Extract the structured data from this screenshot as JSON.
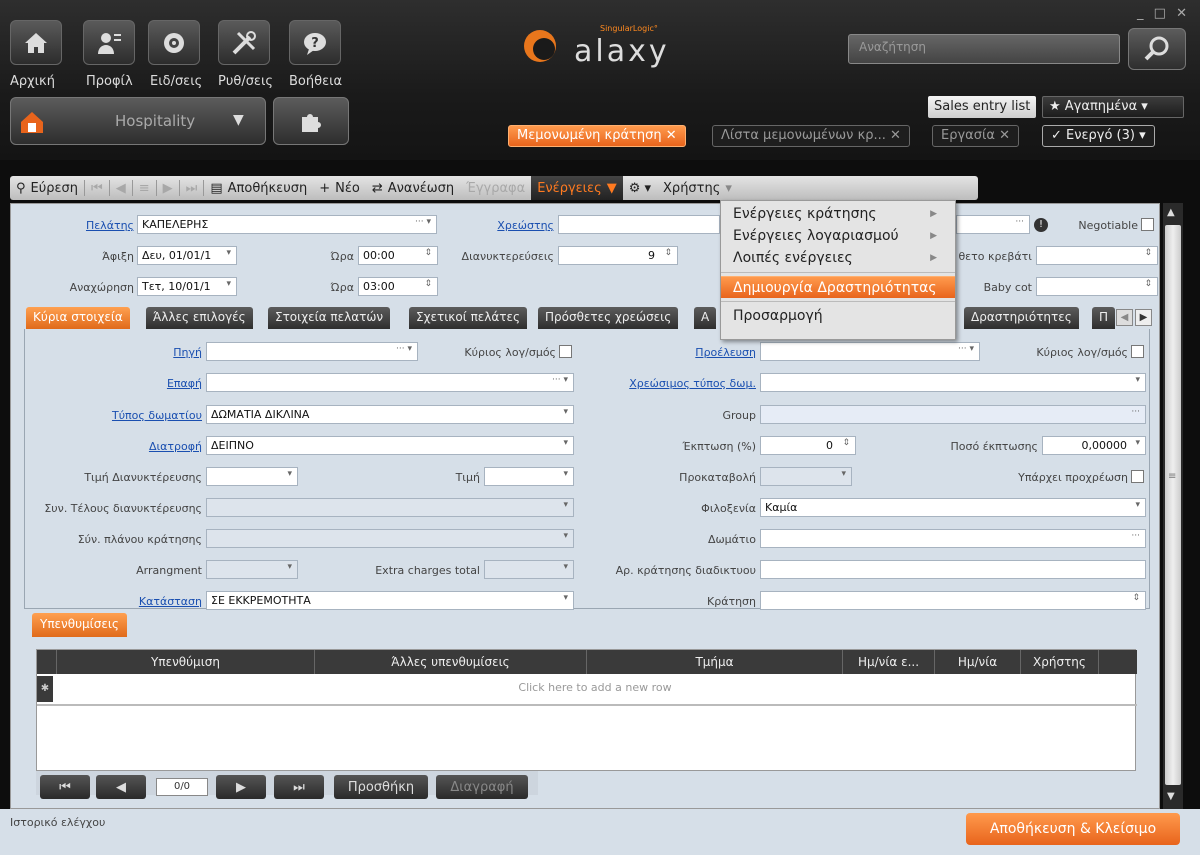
{
  "window": {
    "controls": "_ □ ✕"
  },
  "nav": [
    {
      "label": "Αρχική",
      "icon": "home-icon"
    },
    {
      "label": "Προφίλ",
      "icon": "profile-icon"
    },
    {
      "label": "Ειδ/σεις",
      "icon": "notifications-icon"
    },
    {
      "label": "Ρυθ/σεις",
      "icon": "settings-tools-icon"
    },
    {
      "label": "Βοήθεια",
      "icon": "help-icon"
    }
  ],
  "app": {
    "module": "Hospitality",
    "logo_small": "SingularLogic°",
    "logo_text": "alaxy",
    "logo_initial": "G"
  },
  "search": {
    "placeholder": "Αναζήτηση"
  },
  "quick": {
    "sales": "Sales entry list",
    "favorites": "★ Αγαπημένα ▾"
  },
  "tabs": [
    {
      "label": "Μεμονωμένη κράτηση ✕"
    },
    {
      "label": "Λίστα μεμονωμένων κρ... ✕"
    },
    {
      "label": "Εργασία ✕"
    },
    {
      "label": "✓ Ενεργό (3) ▾"
    }
  ],
  "toolbar": {
    "find": "Εύρεση",
    "save": "Αποθήκευση",
    "new": "Νέο",
    "refresh": "Ανανέωση",
    "docs": "Έγγραφα",
    "actions": "Ενέργειες",
    "user": "Χρήστης"
  },
  "menu": {
    "items": [
      "Ενέργειες κράτησης",
      "Ενέργειες λογαριασμού",
      "Λοιπές ενέργειες",
      "Δημιουργία Δραστηριότητας",
      "Προσαρμογή"
    ]
  },
  "header": {
    "client_label": "Πελάτης",
    "client": "ΚΑΠΕΛΕΡΗΣ",
    "debtor_label": "Χρεώστης",
    "negotiable": "Negotiable",
    "arrival_label": "Άφιξη",
    "arrival": "Δευ, 01/01/1",
    "time_label": "Ώρα",
    "arr_time": "00:00",
    "nights_label": "Διανυκτερεύσεις",
    "nights": "9",
    "departure_label": "Αναχώρηση",
    "departure": "Τετ, 10/01/1",
    "dep_time": "03:00",
    "extra_bed": "θετο κρεβάτι",
    "babycot": "Baby cot"
  },
  "subtabs": [
    "Κύρια στοιχεία",
    "Άλλες επιλογές",
    "Στοιχεία πελατών",
    "Σχετικοί πελάτες",
    "Πρόσθετες χρεώσεις",
    "Α",
    "Δραστηριότητες",
    "Π"
  ],
  "form": {
    "source": "Πηγή",
    "main_acc": "Κύριος λογ/σμός",
    "origin": "Προέλευση",
    "contact": "Επαφή",
    "charge_room": "Χρεώσιμος τύπος δωμ.",
    "roomtype_label": "Τύπος δωματίου",
    "roomtype": "ΔΩΜΑΤΙΑ ΔΙΚΛΙΝΑ",
    "group": "Group",
    "board_label": "Διατροφή",
    "board": "ΔΕΙΠΝΟ",
    "discount_label": "Έκπτωση (%)",
    "discount": "0",
    "disc_amt_label": "Ποσό έκπτωσης",
    "disc_amt": "0,00000",
    "night_price": "Τιμή Διανυκτέρευσης",
    "price": "Τιμή",
    "deposit": "Προκαταβολή",
    "precharge": "Υπάρχει προχρέωση",
    "tax": "Συν. Τέλους διανυκτέρευσης",
    "hospitality_label": "Φιλοξενία",
    "hospitality": "Καμία",
    "plan": "Σύν. πλάνου κράτησης",
    "room": "Δωμάτιο",
    "arrangement": "Arrangment",
    "extra_charges": "Extra charges total",
    "web_res": "Αρ. κράτησης διαδικτυου",
    "status_label": "Κατάσταση",
    "status": "ΣΕ ΕΚΚΡΕΜΟΤΗΤΑ",
    "booking": "Κράτηση"
  },
  "reminders": {
    "tab": "Υπενθυμίσεις",
    "columns": [
      "Υπενθύμιση",
      "Άλλες υπενθυμίσεις",
      "Τμήμα",
      "Ημ/νία ε...",
      "Ημ/νία",
      "Χρήστης"
    ],
    "new_row": "Click here to add a new row",
    "pager": "0/0",
    "add": "Προσθήκη",
    "delete": "Διαγραφή"
  },
  "footer": {
    "audit": "Ιστορικό ελέγχου",
    "save_close": "Αποθήκευση & Κλείσιμο"
  }
}
